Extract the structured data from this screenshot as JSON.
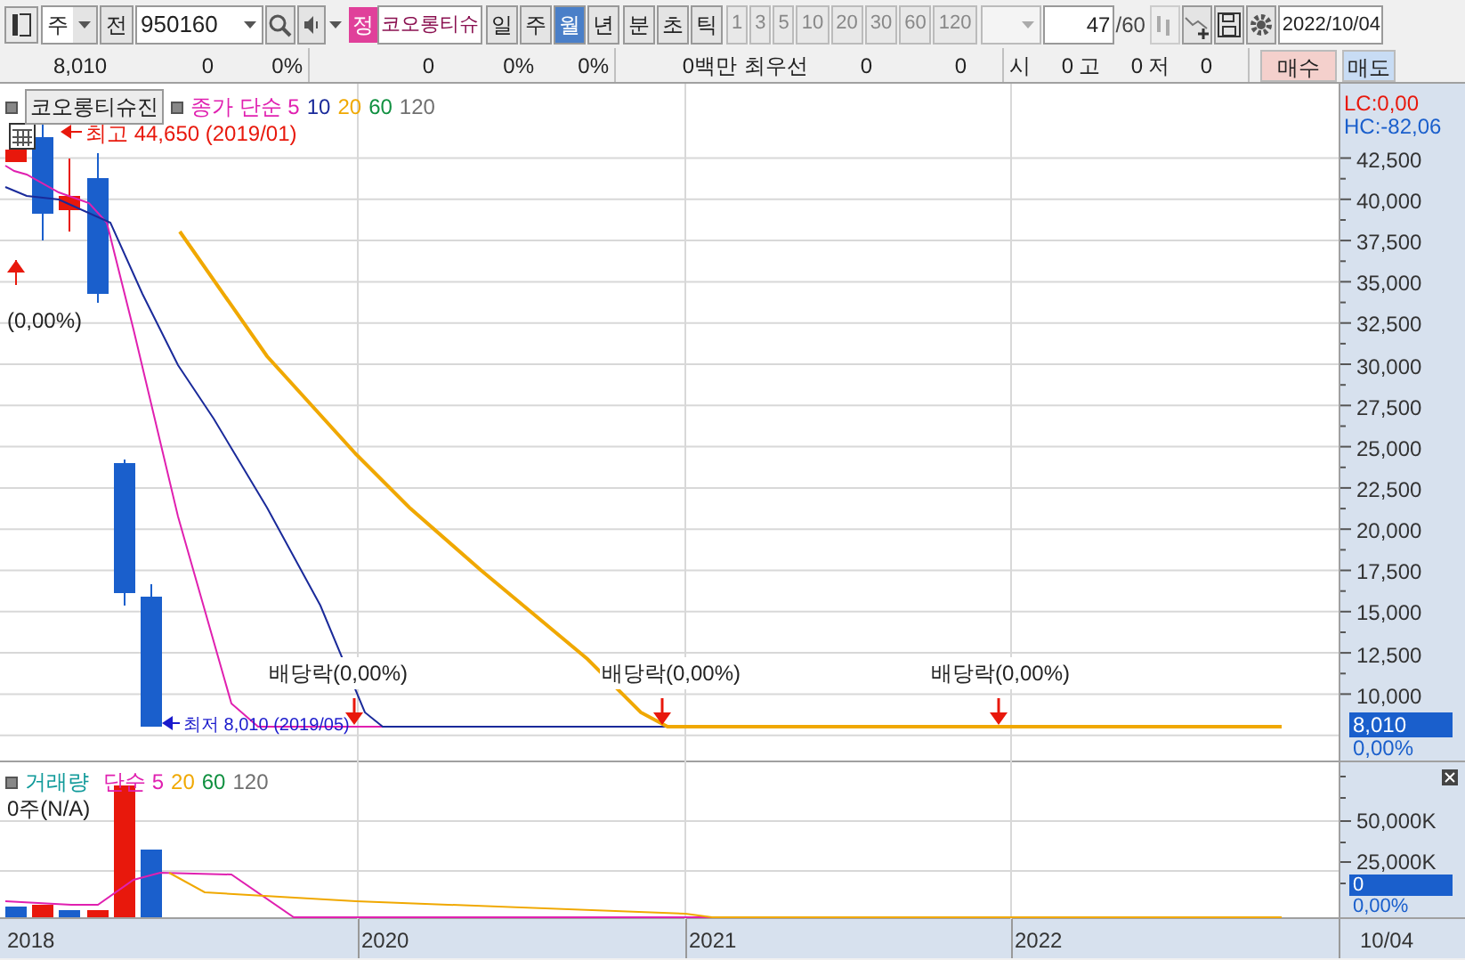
{
  "toolbar": {
    "period_type": "주",
    "prev_button": "전",
    "code": "950160",
    "badge": "정",
    "name": "코오롱티슈",
    "periods": [
      {
        "label": "일",
        "selected": false
      },
      {
        "label": "주",
        "selected": false
      },
      {
        "label": "월",
        "selected": true
      },
      {
        "label": "년",
        "selected": false
      }
    ],
    "intraday": [
      "분",
      "초",
      "틱"
    ],
    "intervals": [
      {
        "label": "1",
        "disabled": true
      },
      {
        "label": "3",
        "disabled": true
      },
      {
        "label": "5",
        "disabled": true
      },
      {
        "label": "10",
        "disabled": true
      },
      {
        "label": "20",
        "disabled": true
      },
      {
        "label": "30",
        "disabled": true
      },
      {
        "label": "60",
        "disabled": true
      },
      {
        "label": "120",
        "disabled": true
      }
    ],
    "count": "47",
    "count_total": "/60",
    "date": "2022/10/04"
  },
  "quote_bar": {
    "price": "8,010",
    "change": "0",
    "change_rate": "0%",
    "volume": "0",
    "rate_1": "0%",
    "rate_2": "0%",
    "amount": "0백만",
    "best_label": "최우선",
    "best_values": [
      "0",
      "0"
    ],
    "ohl": [
      {
        "label": "시",
        "value": "0"
      },
      {
        "label": "고",
        "value": "0"
      },
      {
        "label": "저",
        "value": "0"
      }
    ],
    "buy": "매수",
    "sell": "매도"
  },
  "price_chart": {
    "title": "코오롱티슈진",
    "ma_lines": [
      {
        "label": "종가 단순 5",
        "color": "#e020b0"
      },
      {
        "label": "10",
        "color": "#1a2a9a"
      },
      {
        "label": "20",
        "color": "#f0a800"
      },
      {
        "label": "60",
        "color": "#109040"
      },
      {
        "label": "120",
        "color": "#707070"
      }
    ],
    "high_note": "최고 44,650 (2019/01)",
    "low_note": "최저 8,010 (2019/05)",
    "listing_note": "(0,00%)",
    "dividend_notes": [
      "배당락(0,00%)",
      "배당락(0,00%)",
      "배당락(0,00%)"
    ],
    "lc": "LC:0,00",
    "hc": "HC:-82,06",
    "y_ticks": [
      "42,500",
      "40,000",
      "37,500",
      "35,000",
      "32,500",
      "30,000",
      "27,500",
      "25,000",
      "22,500",
      "20,000",
      "17,500",
      "15,000",
      "12,500",
      "10,000"
    ],
    "last_price": "8,010",
    "last_change": "0,00%"
  },
  "volume_chart": {
    "title": "거래량",
    "ma_lines": [
      {
        "label": "단순 5",
        "color": "#e020b0"
      },
      {
        "label": "20",
        "color": "#f0a800"
      },
      {
        "label": "60",
        "color": "#109040"
      },
      {
        "label": "120",
        "color": "#707070"
      }
    ],
    "reading": "0주(N/A)",
    "y_ticks": [
      "50,000K",
      "25,000K"
    ],
    "last_volume": "0",
    "last_change": "0,00%"
  },
  "time_axis": [
    "2018",
    "2020",
    "2021",
    "2022",
    "10/04"
  ]
}
